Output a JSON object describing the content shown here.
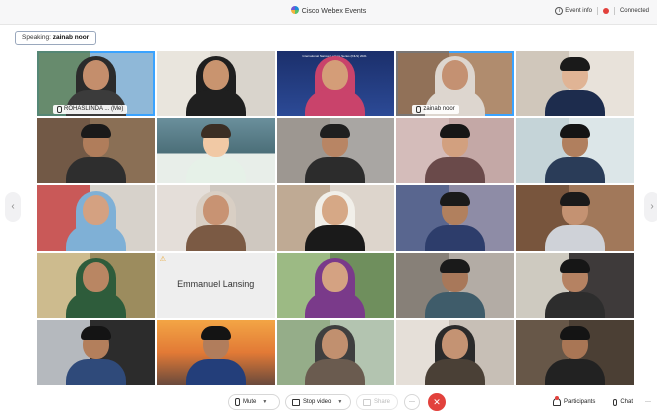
{
  "app": {
    "title": "Cisco Webex Events",
    "event_info": "Event info",
    "status": "Connected",
    "brand_color": "#1d8bd8"
  },
  "speaking": {
    "label": "Speaking:",
    "name": "zainab noor"
  },
  "grid": {
    "tiles": [
      {
        "name_label": "ROHASLINDA ... (Me)",
        "bg": "#8fb8d8",
        "skin": "#c48e6c",
        "cover": "hijab",
        "cover_color": "#2b2b2b",
        "body": "#3b3b3b",
        "active": true,
        "scene": "#5d7f52"
      },
      {
        "bg": "#d9d4cc",
        "skin": "#c9946f",
        "cover": "hijab",
        "cover_color": "#1f1f1f",
        "body": "#1f1f1f",
        "scene": "#ece8e1"
      },
      {
        "bg": "#203a7a",
        "skin": "#d49d78",
        "cover": "hijab",
        "cover_color": "#c9436b",
        "body": "#c9436b",
        "scene": "slide",
        "slide_title": "International Narrow Lecture Series (INLS) 2021"
      },
      {
        "name_label": "zainab noor",
        "bg": "#b08c6e",
        "skin": "#c49172",
        "cover": "hijab",
        "cover_color": "#ddd6cf",
        "body": "#ddd6cf",
        "active": true,
        "scene": "#8a6a52"
      },
      {
        "bg": "#e8e2da",
        "skin": "#e0b495",
        "cover": "hair",
        "cover_color": "#1a1a1a",
        "body": "#1d2c4d",
        "scene": "#c9c1b3"
      },
      {
        "bg": "#8a6f55",
        "skin": "#b07d5b",
        "cover": "hair",
        "cover_color": "#1a1a1a",
        "body": "#2e2e2e",
        "scene": "#6b5442"
      },
      {
        "bg": "#3c5a66",
        "skin": "#f1c9a5",
        "cover": "hair",
        "cover_color": "#3b2e24",
        "body": "#e6f1e8",
        "scene": "anime"
      },
      {
        "bg": "#a9a6a3",
        "skin": "#b88564",
        "cover": "hair",
        "cover_color": "#1f1f1f",
        "body": "#2c2c2c",
        "scene": "#9a938c"
      },
      {
        "bg": "#c4a8a6",
        "skin": "#d2a07f",
        "cover": "hair",
        "cover_color": "#161616",
        "body": "#6a4a4a",
        "scene": "#d8c1bf"
      },
      {
        "bg": "#dce6e8",
        "skin": "#b07f5e",
        "cover": "hair",
        "cover_color": "#141414",
        "body": "#2a3c58",
        "scene": "#bfcfd3"
      },
      {
        "bg": "#d7d2cb",
        "skin": "#d4a181",
        "cover": "hijab",
        "cover_color": "#7fb0d6",
        "body": "#7fb0d6",
        "scene": "#c63b3b"
      },
      {
        "bg": "#cfc8c0",
        "skin": "#c89373",
        "cover": "hijab",
        "cover_color": "#d9cfc4",
        "body": "#7b5a44",
        "scene": "#e9e4de"
      },
      {
        "bg": "#ddd5cc",
        "skin": "#d6a886",
        "cover": "hijab",
        "cover_color": "#f1efe9",
        "body": "#1a1a1a",
        "scene": "#b89f86"
      },
      {
        "bg": "#8e8ca6",
        "skin": "#b1805e",
        "cover": "hair",
        "cover_color": "#1a1a1a",
        "body": "#2d3d6b",
        "scene": "#4c5c8a"
      },
      {
        "bg": "#a1785a",
        "skin": "#c49272",
        "cover": "hair",
        "cover_color": "#1a1a1a",
        "body": "#cfd2d8",
        "scene": "#6e4c36"
      },
      {
        "bg": "#9c8c5e",
        "skin": "#b98663",
        "cover": "hijab",
        "cover_color": "#2e5c3b",
        "body": "#2e5c3b",
        "scene": "#d9c79a"
      },
      {
        "bg": "#eeeeee",
        "name_only": "Emmanuel Lansing",
        "warn": "⚠"
      },
      {
        "bg": "#6f8f5d",
        "skin": "#d4a282",
        "cover": "hijab",
        "cover_color": "#7a3a8a",
        "body": "#7a3a8a",
        "scene": "#a7c48f"
      },
      {
        "bg": "#b3aca5",
        "skin": "#a8785a",
        "cover": "hair",
        "cover_color": "#1a1a1a",
        "body": "#3f5c6a",
        "scene": "#7c756d"
      },
      {
        "bg": "#3e3a3a",
        "skin": "#b58262",
        "cover": "hair",
        "cover_color": "#161616",
        "body": "#2d2d2d",
        "scene": "#f3efe2"
      },
      {
        "bg": "#2c2c2c",
        "skin": "#b37f5c",
        "cover": "hair",
        "cover_color": "#141414",
        "body": "#2f4a7a",
        "scene": "#d8dde3"
      },
      {
        "bg": "#d98a42",
        "skin": "#b17d5c",
        "cover": "hair",
        "cover_color": "#141414",
        "body": "#233e7a",
        "scene": "sunset"
      },
      {
        "bg": "#b3c4b0",
        "skin": "#c1906f",
        "cover": "hijab",
        "cover_color": "#3f3f3f",
        "body": "#6a5b4f",
        "scene": "#8da87f"
      },
      {
        "bg": "#c7bfb6",
        "skin": "#c49373",
        "cover": "hijab",
        "cover_color": "#2a2a2a",
        "body": "#4a4036",
        "scene": "#ece7e1"
      },
      {
        "bg": "#4b3f34",
        "skin": "#a97655",
        "cover": "hair",
        "cover_color": "#141414",
        "body": "#222222",
        "scene": "#6e5e4e"
      }
    ]
  },
  "controls": {
    "mute": "Mute",
    "stop_video": "Stop video",
    "share": "Share",
    "more": "···",
    "participants": "Participants",
    "chat": "Chat",
    "end_color": "#e2413c"
  },
  "nav": {
    "prev": "‹",
    "next": "›"
  }
}
